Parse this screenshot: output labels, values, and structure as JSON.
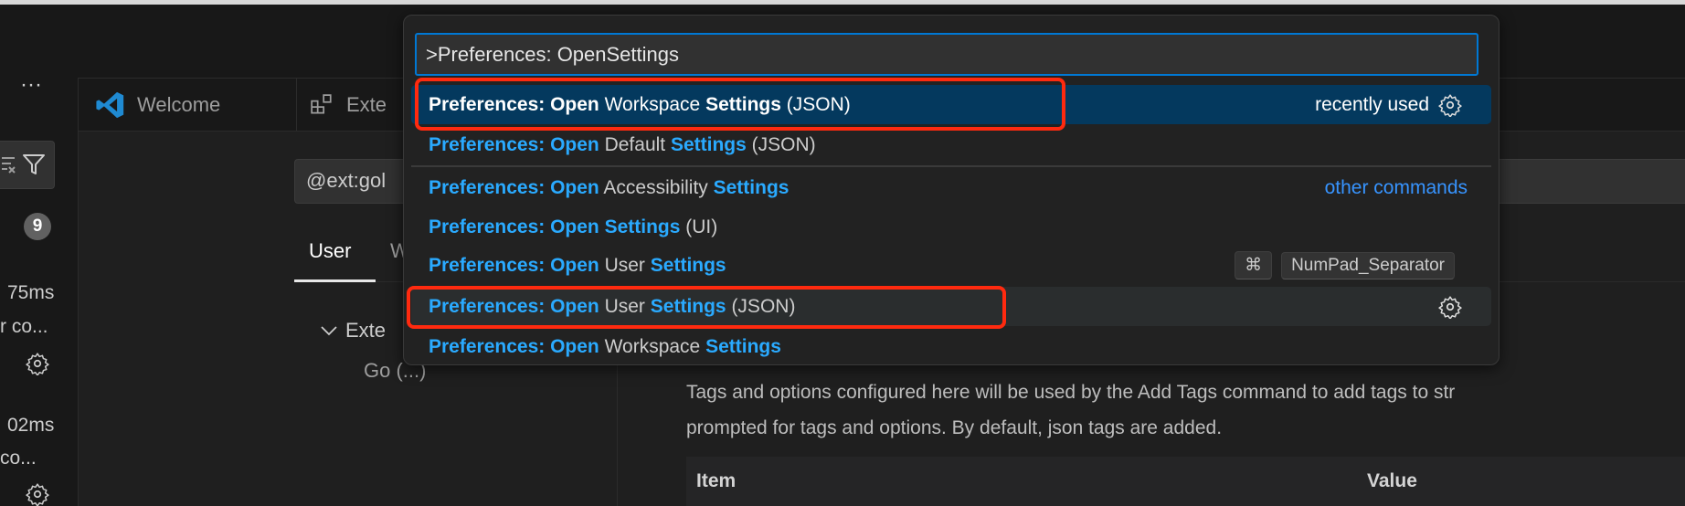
{
  "sidebar": {
    "more_label": "···",
    "badge_count": "9",
    "items": [
      {
        "time": "75ms",
        "desc": "r co..."
      },
      {
        "time": "02ms",
        "desc": "co..."
      }
    ]
  },
  "tabs": [
    {
      "label": "Welcome",
      "icon": "vscode-logo-icon"
    },
    {
      "label": "Exte",
      "icon": "extensions-icon"
    }
  ],
  "settings": {
    "search_value": "@ext:gol",
    "scope_tabs": [
      "User",
      "W"
    ],
    "tree": [
      "Exte",
      "Go (...)"
    ],
    "description_lines": [
      "Tags and options configured here will be used by the Add Tags command to add tags to str",
      "prompted for tags and options. By default, json tags are added."
    ],
    "table_headers": [
      "Item",
      "Value"
    ]
  },
  "quick_pick": {
    "input_value": ">Preferences: OpenSettings",
    "rows": [
      {
        "segments": [
          [
            "Preferences: Open",
            true
          ],
          [
            " Workspace ",
            false
          ],
          [
            "Settings",
            true
          ],
          [
            " (JSON)",
            false
          ]
        ],
        "detail": "recently used",
        "gear": true,
        "state": "selected"
      },
      {
        "segments": [
          [
            "Preferences: Open",
            true
          ],
          [
            " Default ",
            false
          ],
          [
            "Settings",
            true
          ],
          [
            " (JSON)",
            false
          ]
        ]
      },
      {
        "segments": [
          [
            "Preferences: Open",
            true
          ],
          [
            " Accessibility ",
            false
          ],
          [
            "Settings",
            true
          ]
        ],
        "detail_link": "other commands"
      },
      {
        "segments": [
          [
            "Preferences: Open",
            true
          ],
          [
            " ",
            false
          ],
          [
            "Settings",
            true
          ],
          [
            " (UI)",
            false
          ]
        ]
      },
      {
        "segments": [
          [
            "Preferences: Open",
            true
          ],
          [
            " User ",
            false
          ],
          [
            "Settings",
            true
          ]
        ],
        "keys": [
          "⌘",
          "NumPad_Separator"
        ]
      },
      {
        "segments": [
          [
            "Preferences: Open",
            true
          ],
          [
            " User ",
            false
          ],
          [
            "Settings",
            true
          ],
          [
            " (JSON)",
            false
          ]
        ],
        "gear": true,
        "state": "hover"
      },
      {
        "segments": [
          [
            "Preferences: Open",
            true
          ],
          [
            " Workspace ",
            false
          ],
          [
            "Settings",
            true
          ]
        ]
      }
    ],
    "highlight_color": "#2aaaff",
    "selected_bg": "#04395e",
    "annotation_color": "#ff2a0f"
  }
}
